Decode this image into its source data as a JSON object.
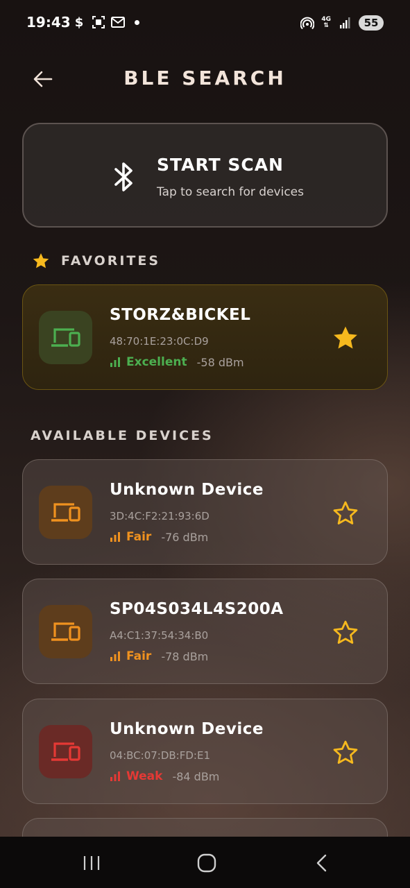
{
  "status_bar": {
    "time": "19:43",
    "network": "4G",
    "battery": "55",
    "left_icons": [
      "dollar-app-icon",
      "screenshot-icon",
      "mail-icon",
      "notification-dot"
    ],
    "right_icons": [
      "hotspot-icon",
      "4g-data-icon",
      "signal-icon",
      "battery-icon"
    ]
  },
  "header": {
    "title": "BLE SEARCH",
    "back_icon": "arrow-left-icon"
  },
  "scan": {
    "title": "START SCAN",
    "subtitle": "Tap to search for devices",
    "icon": "bluetooth-icon"
  },
  "favorites": {
    "heading": "FAVORITES",
    "icon": "star-filled-icon",
    "devices": [
      {
        "name": "STORZ&BICKEL",
        "mac": "48:70:1E:23:0C:D9",
        "signal_label": "Excellent",
        "rssi": "-58 dBm",
        "favorite": true
      }
    ]
  },
  "available": {
    "heading": "AVAILABLE DEVICES",
    "devices": [
      {
        "name": "Unknown Device",
        "mac": "3D:4C:F2:21:93:6D",
        "signal_label": "Fair",
        "rssi": "-76 dBm",
        "favorite": false
      },
      {
        "name": "SP04S034L4S200A",
        "mac": "A4:C1:37:54:34:B0",
        "signal_label": "Fair",
        "rssi": "-78 dBm",
        "favorite": false
      },
      {
        "name": "Unknown Device",
        "mac": "04:BC:07:DB:FD:E1",
        "signal_label": "Weak",
        "rssi": "-84 dBm",
        "favorite": false
      }
    ]
  },
  "colors": {
    "excellent": "#4caf50",
    "fair": "#f0921f",
    "weak": "#e53935",
    "star": "#f6b91e",
    "title": "#f2e4da"
  },
  "nav_bar": {
    "icons": [
      "recent-apps-icon",
      "home-icon",
      "back-icon"
    ]
  }
}
